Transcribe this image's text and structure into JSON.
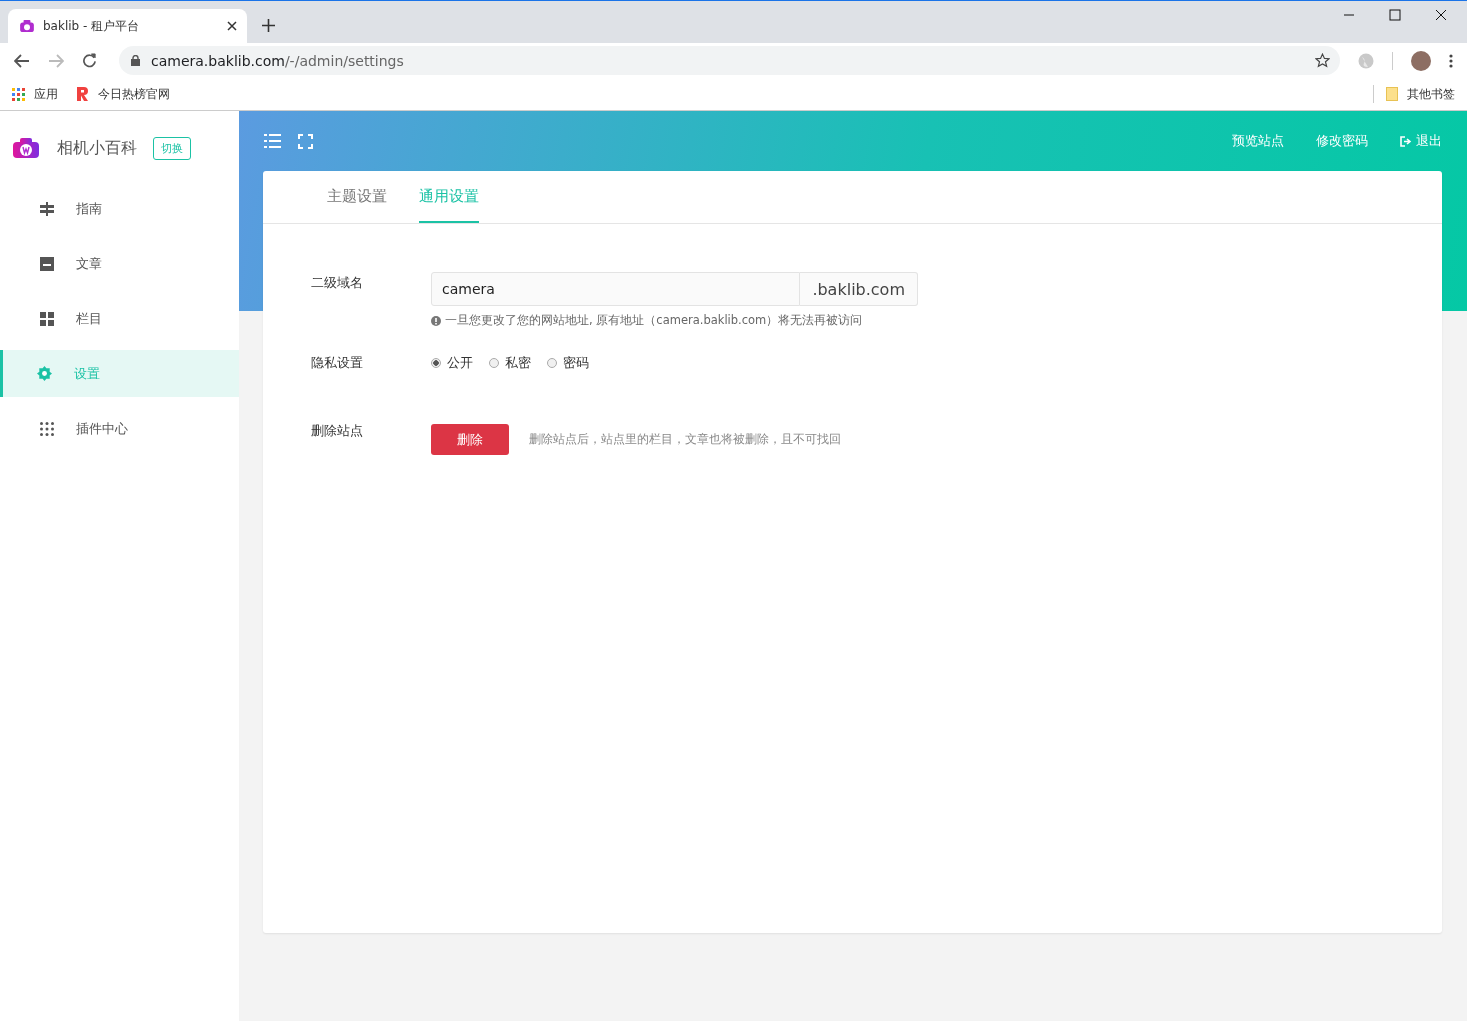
{
  "browser": {
    "tab_title": "baklib - 租户平台",
    "url_host": "camera.baklib.com",
    "url_path": "/-/admin/settings",
    "bookmarks": [
      {
        "kind": "apps",
        "label": "应用"
      },
      {
        "kind": "r",
        "label": "今日热榜官网"
      }
    ],
    "other_bookmarks": "其他书签"
  },
  "sidebar": {
    "site_name": "相机小百科",
    "switch_button": "切换",
    "items": [
      {
        "kind": "guide",
        "label": "指南",
        "selected": false
      },
      {
        "kind": "article",
        "label": "文章",
        "selected": false
      },
      {
        "kind": "column",
        "label": "栏目",
        "selected": false
      },
      {
        "kind": "settings",
        "label": "设置",
        "selected": true
      },
      {
        "kind": "plugins",
        "label": "插件中心",
        "selected": false
      }
    ]
  },
  "header": {
    "actions": [
      {
        "kind": "link",
        "label": "预览站点"
      },
      {
        "kind": "link",
        "label": "修改密码"
      },
      {
        "kind": "logout",
        "label": "退出"
      }
    ]
  },
  "tabs": [
    {
      "label": "主题设置",
      "selected": false
    },
    {
      "label": "通用设置",
      "selected": true
    }
  ],
  "form": {
    "domain": {
      "label": "二级域名",
      "value": "camera",
      "suffix": ".baklib.com",
      "hint": "一旦您更改了您的网站地址, 原有地址（camera.baklib.com）将无法再被访问"
    },
    "privacy": {
      "label": "隐私设置",
      "options": [
        {
          "label": "公开",
          "selected": true
        },
        {
          "label": "私密",
          "selected": false
        },
        {
          "label": "密码",
          "selected": false
        }
      ]
    },
    "delete": {
      "label": "删除站点",
      "button": "删除",
      "note": "删除站点后，站点里的栏目，文章也将被删除，且不可找回"
    }
  }
}
